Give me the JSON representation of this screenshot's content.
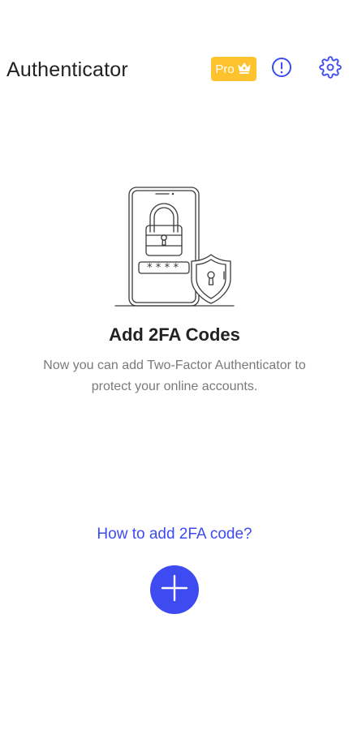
{
  "header": {
    "title": "Authenticator",
    "pro_label": "Pro",
    "info_icon": "info-exclamation-icon",
    "settings_icon": "gear-icon",
    "crown_icon": "crown-icon"
  },
  "empty_state": {
    "illustration_icon": "phone-lock-shield-illustration",
    "password_mask": "****",
    "title": "Add 2FA Codes",
    "description": "Now you can add Two-Factor Authenticator to protect your online accounts."
  },
  "help_link": "How to add 2FA code?",
  "add_button": {
    "icon": "plus-icon"
  },
  "colors": {
    "accent": "#3D4BF0",
    "pro_badge": "#FDC22D",
    "title_text": "#222222",
    "description_text": "#7A7A7A"
  }
}
